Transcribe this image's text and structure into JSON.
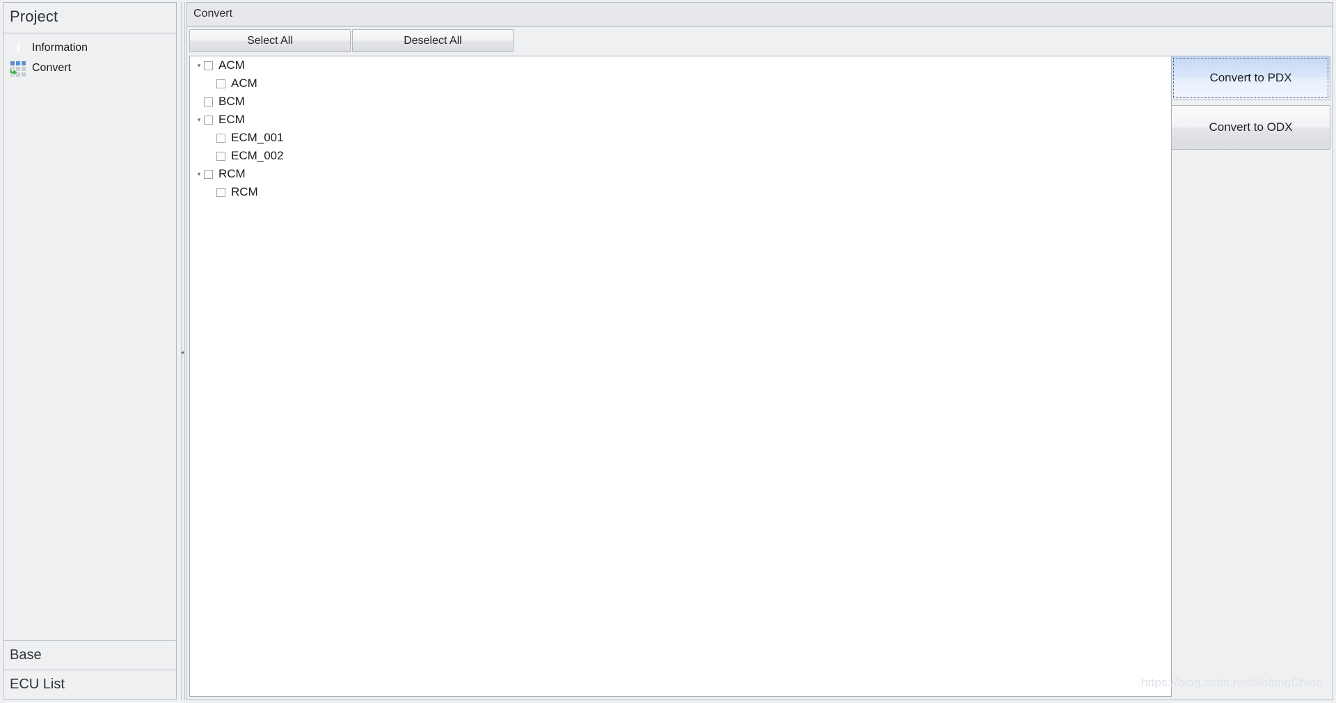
{
  "sidebar": {
    "header_title": "Project",
    "items": [
      {
        "label": "Information",
        "icon": "info-icon"
      },
      {
        "label": "Convert",
        "icon": "convert-grid-icon"
      }
    ],
    "collapsed_panels": [
      {
        "label": "Base"
      },
      {
        "label": "ECU List"
      }
    ]
  },
  "main": {
    "title": "Convert",
    "toolbar": {
      "select_all_label": "Select All",
      "deselect_all_label": "Deselect All"
    },
    "tree": {
      "expand_arrow_glyph": "▾",
      "nodes": [
        {
          "label": "ACM",
          "level": 0,
          "expandable": true,
          "expanded": true,
          "checked": false
        },
        {
          "label": "ACM",
          "level": 1,
          "expandable": false,
          "expanded": false,
          "checked": false
        },
        {
          "label": "BCM",
          "level": 0,
          "expandable": false,
          "expanded": false,
          "checked": false
        },
        {
          "label": "ECM",
          "level": 0,
          "expandable": true,
          "expanded": true,
          "checked": false
        },
        {
          "label": "ECM_001",
          "level": 1,
          "expandable": false,
          "expanded": false,
          "checked": false
        },
        {
          "label": "ECM_002",
          "level": 1,
          "expandable": false,
          "expanded": false,
          "checked": false
        },
        {
          "label": "RCM",
          "level": 0,
          "expandable": true,
          "expanded": true,
          "checked": false
        },
        {
          "label": "RCM",
          "level": 1,
          "expandable": false,
          "expanded": false,
          "checked": false
        }
      ]
    },
    "actions": [
      {
        "label": "Convert to PDX",
        "state": "focused"
      },
      {
        "label": "Convert to ODX",
        "state": "normal"
      }
    ]
  },
  "splitter": {
    "collapse_glyph": "◂"
  },
  "watermark": {
    "text": "https://blog.csdn.net/SoftingChina"
  },
  "colors": {
    "window_background": "#eff0f1",
    "panel_border": "#b8bcc2",
    "tree_background": "#ffffff",
    "focus_accent": "#c6d8f5",
    "text_primary": "#1b1b1b",
    "icon_blue": "#5b8fd4",
    "icon_gray": "#c9ccd2",
    "icon_green": "#4caf50",
    "watermark": "#dfe2e8"
  }
}
